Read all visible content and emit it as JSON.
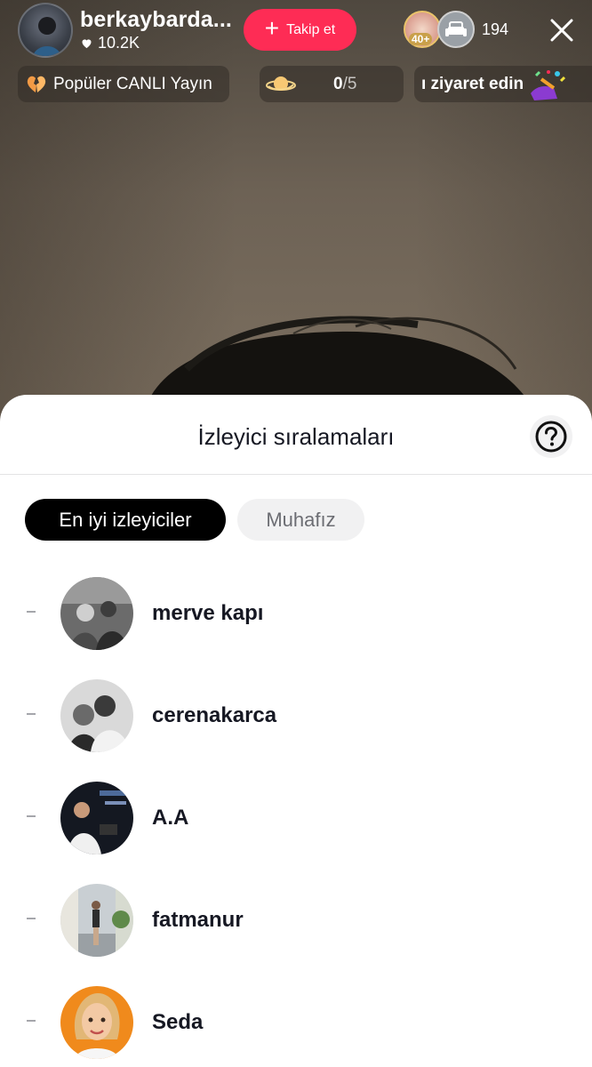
{
  "host": {
    "name": "berkaybarda...",
    "likes": "10.2K",
    "follow_label": "Takip et",
    "viewer_count": "194",
    "viewer_badge": "40+"
  },
  "pills": {
    "popular_label": "Popüler CANLI Yayın",
    "goal_current": "0",
    "goal_total": "/5",
    "visit_label": "ı ziyaret edin"
  },
  "sheet": {
    "title": "İzleyici sıralamaları",
    "tabs": [
      {
        "label": "En iyi izleyiciler",
        "active": true
      },
      {
        "label": "Muhafız",
        "active": false
      }
    ],
    "viewers": [
      {
        "rank": "-",
        "name": "merve kapı"
      },
      {
        "rank": "-",
        "name": "cerenakarca"
      },
      {
        "rank": "-",
        "name": "A.A"
      },
      {
        "rank": "-",
        "name": "fatmanur"
      },
      {
        "rank": "-",
        "name": "Seda"
      }
    ]
  },
  "colors": {
    "accent": "#fe2c55",
    "text_primary": "#161823",
    "tab_active_bg": "#000000",
    "tab_inactive_bg": "#f1f1f2"
  },
  "icons": {
    "close": "close-icon",
    "heart": "heart-icon",
    "help": "question-circle-icon",
    "plus": "plus-icon"
  }
}
